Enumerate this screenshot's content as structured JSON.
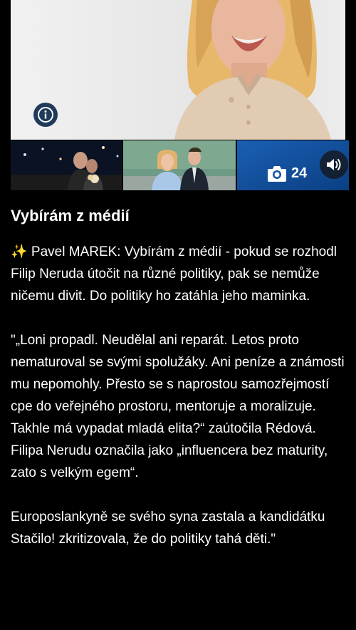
{
  "article": {
    "title": "Vybírám z médií",
    "paragraphs": [
      "✨ Pavel MAREK: Vybírám z médií - pokud se rozhodl Filip Neruda útočit na různé politiky, pak se nemůže ničemu divit. Do politiky ho zatáhla jeho maminka.",
      "\"„Loni propadl. Neudělal ani reparát. Letos proto nematuroval se svými spolužáky. Ani peníze a známosti mu nepomohly. Přesto se s naprostou samozřejmostí cpe do veřejného prostoru, mentoruje a moralizuje. Takhle má vypadat mladá elita?“ zaútočila Rédová. Filipa Nerudu označila jako „influencera bez maturity, zato s velkým egem“.",
      "Europoslankyně se svého syna zastala a kandidátku Stačilo! zkritizovala, že do politiky tahá děti.\""
    ]
  },
  "gallery": {
    "count": "24"
  },
  "icons": {
    "info": "info-icon",
    "camera": "camera-icon",
    "sound": "speaker-icon",
    "sparkle": "sparkles-icon"
  }
}
